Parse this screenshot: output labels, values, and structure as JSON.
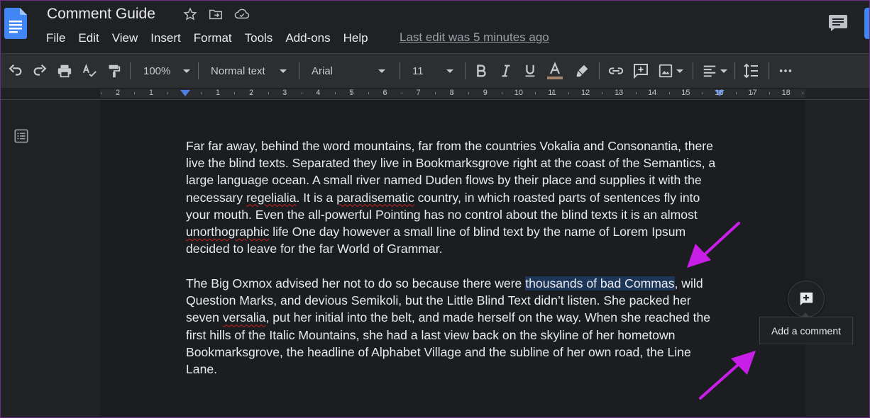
{
  "app": {
    "doc_title": "Comment Guide",
    "last_edit": "Last edit was 5 minutes ago"
  },
  "menu": [
    "File",
    "Edit",
    "View",
    "Insert",
    "Format",
    "Tools",
    "Add-ons",
    "Help"
  ],
  "toolbar": {
    "zoom": "100%",
    "style": "Normal text",
    "font": "Arial",
    "size": "11",
    "icons": [
      "undo-icon",
      "redo-icon",
      "print-icon",
      "spellcheck-icon",
      "paint-format-icon",
      "bold-icon",
      "italic-icon",
      "underline-icon",
      "text-color-icon",
      "highlight-icon",
      "link-icon",
      "insert-comment-icon",
      "image-icon",
      "align-icon",
      "line-spacing-icon",
      "more-icon"
    ],
    "text_color_swatch": "#a2836c"
  },
  "ruler": {
    "labels": [
      "2",
      "1",
      "1",
      "2",
      "3",
      "4",
      "5",
      "6",
      "7",
      "8",
      "9",
      "10",
      "11",
      "12",
      "13",
      "14",
      "15",
      "16",
      "17",
      "18"
    ]
  },
  "document": {
    "p1": {
      "a": "Far far away, behind the word mountains, far from the countries Vokalia and Consonantia, there live the blind texts. Separated they live in Bookmarksgrove right at the coast of the Semantics, a large language ocean. A small river named Duden flows by their place and supplies it with the necessary ",
      "b": "regelialia",
      "c": ". It is a ",
      "d": "paradisematic",
      "e": " country, in which roasted parts of sentences fly into your mouth. Even the all-powerful Pointing has no control about the blind texts it is an almost ",
      "f": "unorthographic",
      "g": " life One day however a small line of blind text by the name of Lorem Ipsum decided to leave for the far World of Grammar."
    },
    "p2": {
      "a": "The Big Oxmox advised her not to do so because there were ",
      "b": "thousands of bad Commas",
      "c": ", wild Question Marks, and devious Semikoli, but the Little Blind Text didn’t listen. She packed her seven ",
      "d": "versalia",
      "e": ", put her initial into the belt, and made herself on the way. When she reached the first hills of the Italic Mountains, she had a last view back on the skyline of her hometown Bookmarksgrove, the headline of Alphabet Village and the subline of her own road, the Line Lane."
    }
  },
  "comment": {
    "tooltip": "Add a comment"
  },
  "colors": {
    "accent": "#4285f4",
    "arrow": "#c81ee8",
    "selection": "#1d3557",
    "spellcheck": "#c5221f"
  }
}
